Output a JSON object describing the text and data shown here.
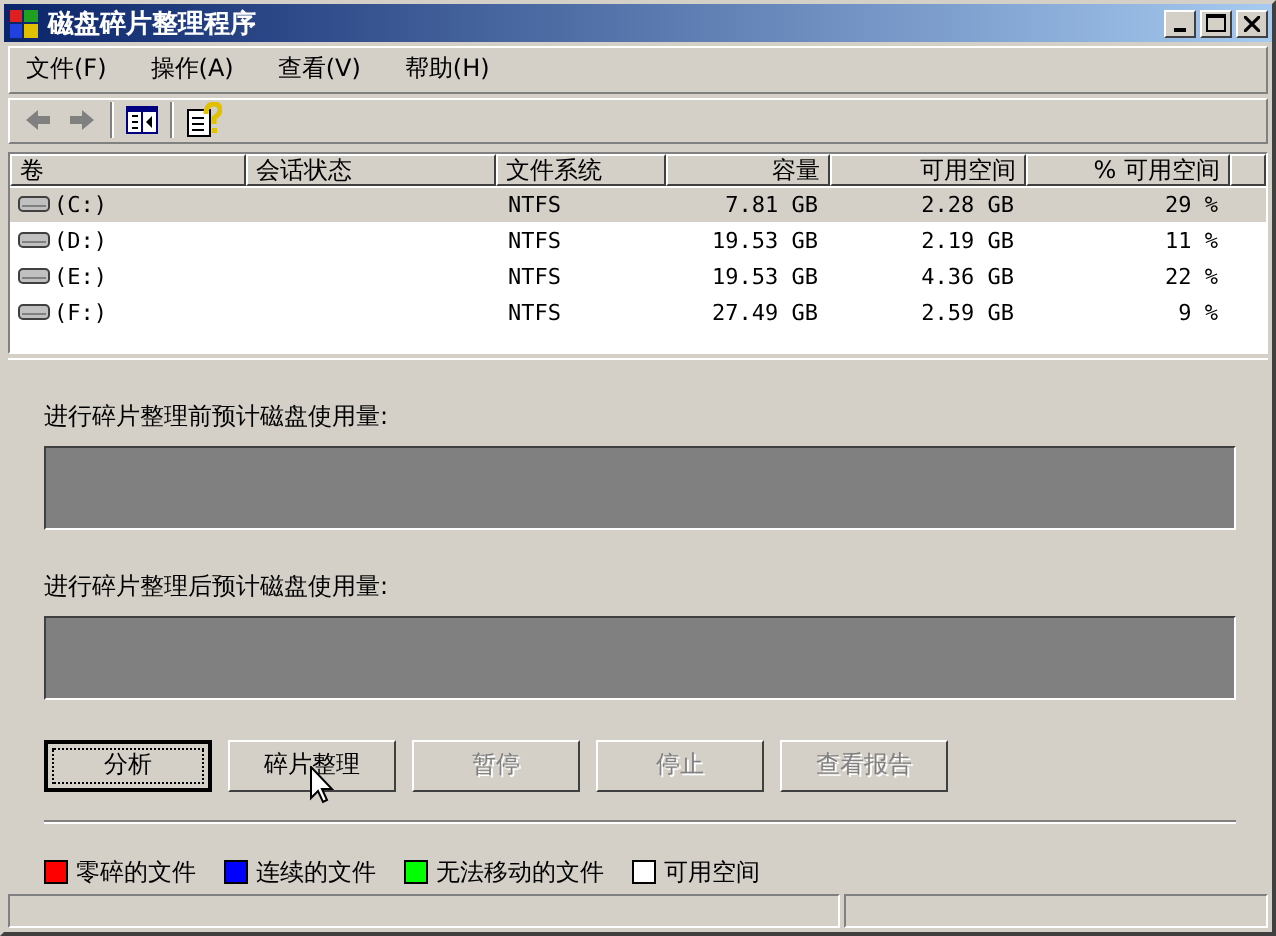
{
  "window": {
    "title": "磁盘碎片整理程序"
  },
  "menu": [
    {
      "label": "文件(F)"
    },
    {
      "label": "操作(A)"
    },
    {
      "label": "查看(V)"
    },
    {
      "label": "帮助(H)"
    }
  ],
  "toolbar": [
    {
      "kind": "back",
      "disabled": true
    },
    {
      "kind": "forward",
      "disabled": true
    },
    {
      "kind": "separator"
    },
    {
      "kind": "panel",
      "disabled": false
    },
    {
      "kind": "separator"
    },
    {
      "kind": "help",
      "disabled": false
    }
  ],
  "table": {
    "columns": [
      {
        "label": "卷"
      },
      {
        "label": "会话状态"
      },
      {
        "label": "文件系统"
      },
      {
        "label": "容量"
      },
      {
        "label": "可用空间"
      },
      {
        "label": "% 可用空间"
      }
    ],
    "rows": [
      {
        "selected": true,
        "cells": [
          "(C:)",
          "",
          "NTFS",
          "7.81 GB",
          "2.28 GB",
          "29 %"
        ]
      },
      {
        "selected": false,
        "cells": [
          "(D:)",
          "",
          "NTFS",
          "19.53 GB",
          "2.19 GB",
          "11 %"
        ]
      },
      {
        "selected": false,
        "cells": [
          "(E:)",
          "",
          "NTFS",
          "19.53 GB",
          "4.36 GB",
          "22 %"
        ]
      },
      {
        "selected": false,
        "cells": [
          "(F:)",
          "",
          "NTFS",
          "27.49 GB",
          "2.59 GB",
          "9 %"
        ]
      }
    ]
  },
  "before": {
    "label": "进行碎片整理前预计磁盘使用量:"
  },
  "after": {
    "label": "进行碎片整理后预计磁盘使用量:"
  },
  "buttons": [
    {
      "label": "分析",
      "disabled": false,
      "focused": true
    },
    {
      "label": "碎片整理",
      "disabled": false,
      "focused": false
    },
    {
      "label": "暂停",
      "disabled": true,
      "focused": false
    },
    {
      "label": "停止",
      "disabled": true,
      "focused": false
    },
    {
      "label": "查看报告",
      "disabled": true,
      "focused": false
    }
  ],
  "legend": [
    {
      "label": "零碎的文件",
      "color": "#ff0000"
    },
    {
      "label": "连续的文件",
      "color": "#0000ff"
    },
    {
      "label": "无法移动的文件",
      "color": "#00ff00"
    },
    {
      "label": "可用空间",
      "color": "#ffffff"
    }
  ]
}
